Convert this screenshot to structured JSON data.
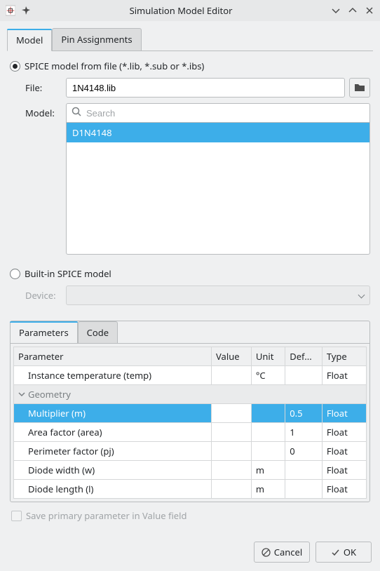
{
  "titlebar": {
    "title": "Simulation Model Editor"
  },
  "tabs": {
    "model": "Model",
    "pin": "Pin Assignments"
  },
  "source": {
    "spice_radio_label": "SPICE model from file (*.lib, *.sub or *.ibs)",
    "file_label": "File:",
    "file_value": "1N4148.lib",
    "model_label": "Model:",
    "search_placeholder": "Search",
    "list_items": [
      "D1N4148"
    ],
    "builtin_radio_label": "Built-in SPICE model",
    "device_label": "Device:"
  },
  "params_tabs": {
    "parameters": "Parameters",
    "code": "Code"
  },
  "params_table": {
    "headers": {
      "parameter": "Parameter",
      "value": "Value",
      "unit": "Unit",
      "def": "Def...",
      "type": "Type"
    },
    "rows": [
      {
        "kind": "row",
        "parameter": "Instance temperature (temp)",
        "value": "",
        "unit": "°C",
        "def": "",
        "type": "Float"
      },
      {
        "kind": "group",
        "parameter": "Geometry"
      },
      {
        "kind": "row",
        "selected": true,
        "parameter": "Multiplier (m)",
        "value": "",
        "unit": "",
        "def": "0.5",
        "type": "Float"
      },
      {
        "kind": "row",
        "parameter": "Area factor (area)",
        "value": "",
        "unit": "",
        "def": "1",
        "type": "Float"
      },
      {
        "kind": "row",
        "parameter": "Perimeter factor (pj)",
        "value": "",
        "unit": "",
        "def": "0",
        "type": "Float"
      },
      {
        "kind": "row",
        "parameter": "Diode width (w)",
        "value": "",
        "unit": "m",
        "def": "",
        "type": "Float"
      },
      {
        "kind": "row",
        "parameter": "Diode length (l)",
        "value": "",
        "unit": "m",
        "def": "",
        "type": "Float"
      }
    ]
  },
  "footer": {
    "save_primary_label": "Save primary parameter in Value field",
    "cancel": "Cancel",
    "ok": "OK"
  }
}
